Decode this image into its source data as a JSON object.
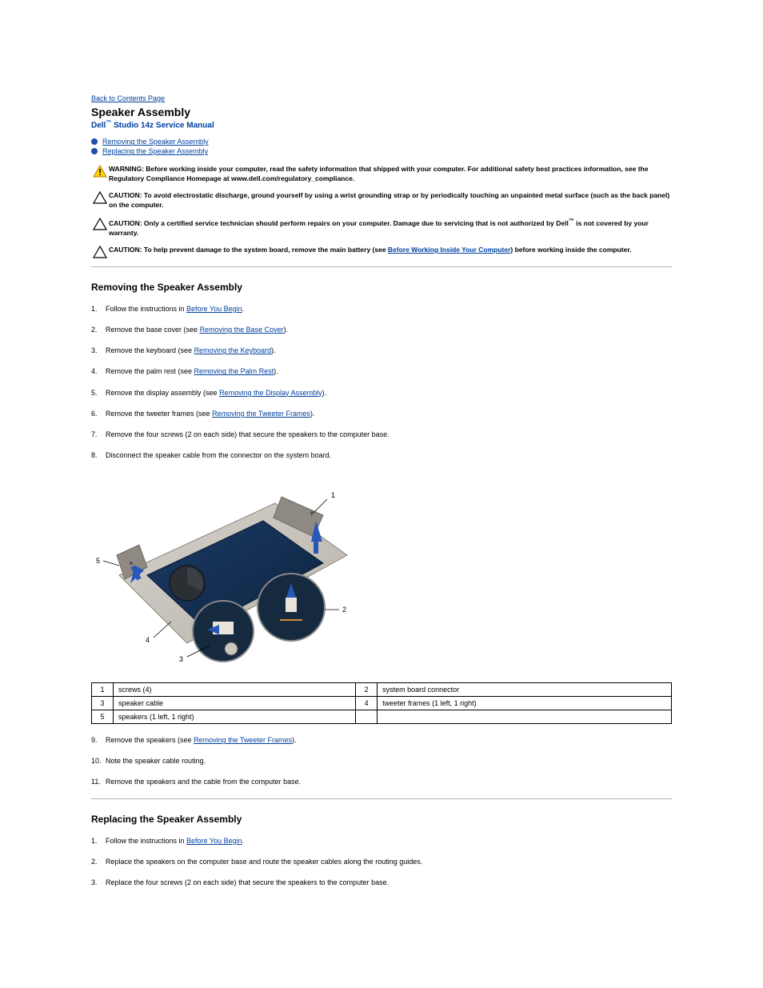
{
  "nav": {
    "back": "Back to Contents Page"
  },
  "titles": {
    "page": "Speaker Assembly",
    "manual_prefix": "Dell",
    "manual_tm": "™",
    "manual_rest": " Studio 14z Service Manual"
  },
  "toc": [
    {
      "label": "Removing the Speaker Assembly"
    },
    {
      "label": "Replacing the Speaker Assembly"
    }
  ],
  "notices": {
    "warning": {
      "label": "WARNING:",
      "text": " Before working inside your computer, read the safety information that shipped with your computer. For additional safety best practices information, see the Regulatory Compliance Homepage at www.dell.com/regulatory_compliance."
    },
    "caution1": {
      "label": "CAUTION:",
      "text": " To avoid electrostatic discharge, ground yourself by using a wrist grounding strap or by periodically touching an unpainted metal surface (such as the back panel) on the computer."
    },
    "caution2": {
      "label": "CAUTION:",
      "text_a": " Only a certified service technician should perform repairs on your computer. Damage due to servicing that is not authorized by Dell",
      "tm": "™",
      "text_b": " is not covered by your warranty."
    },
    "caution3": {
      "label": "CAUTION:",
      "text": " To help prevent damage to the system board, remove the main battery (see ",
      "link": "Before Working Inside Your Computer",
      "text_after": ") before working inside the computer."
    }
  },
  "remove": {
    "heading": "Removing the Speaker Assembly",
    "steps": [
      {
        "pre": "Follow the instructions in ",
        "link": "Before You Begin",
        "post": "."
      },
      {
        "pre": "Remove the base cover (see ",
        "link": "Removing the Base Cover",
        "post": ")."
      },
      {
        "pre": "Remove the keyboard (see ",
        "link": "Removing the Keyboard",
        "post": ")."
      },
      {
        "pre": "Remove the palm rest (see ",
        "link": "Removing the Palm Rest",
        "post": ")."
      },
      {
        "pre": "Remove the display assembly (see ",
        "link": "Removing the Display Assembly",
        "post": ")."
      },
      {
        "pre": "Remove the tweeter frames (see ",
        "link": "Removing the Tweeter Frames",
        "post": ")."
      },
      {
        "pre": "Remove the four screws (2 on each side) that secure the speakers to the computer base.",
        "link": "",
        "post": ""
      },
      {
        "pre": "Disconnect the speaker cable from the connector on the system board.",
        "link": "",
        "post": ""
      }
    ]
  },
  "callouts": {
    "r1c1": "1",
    "r1c2": "screws (4)",
    "r1c3": "2",
    "r1c4": "system board connector",
    "r2c1": "3",
    "r2c2": "speaker cable",
    "r2c3": "4",
    "r2c4": "tweeter frames (1 left, 1 right)",
    "r3c1": "5",
    "r3c2": "speakers (1 left, 1 right)",
    "r3c3": "",
    "r3c4": ""
  },
  "remove2": {
    "steps": [
      {
        "pre": "Remove the speakers (see ",
        "link": "Removing the Tweeter Frames",
        "post": ")."
      },
      {
        "pre": "Note the speaker cable routing.",
        "link": "",
        "post": ""
      },
      {
        "pre": "Remove the speakers and the cable from the computer base.",
        "link": "",
        "post": ""
      }
    ]
  },
  "replace": {
    "heading": "Replacing the Speaker Assembly",
    "steps": [
      {
        "pre": "Follow the instructions in ",
        "link": "Before You Begin",
        "post": "."
      },
      {
        "pre": "Replace the speakers on the computer base and route the speaker cables along the routing guides.",
        "link": "",
        "post": ""
      },
      {
        "pre": "Replace the four screws (2 on each side) that secure the speakers to the computer base.",
        "link": "",
        "post": ""
      }
    ]
  }
}
